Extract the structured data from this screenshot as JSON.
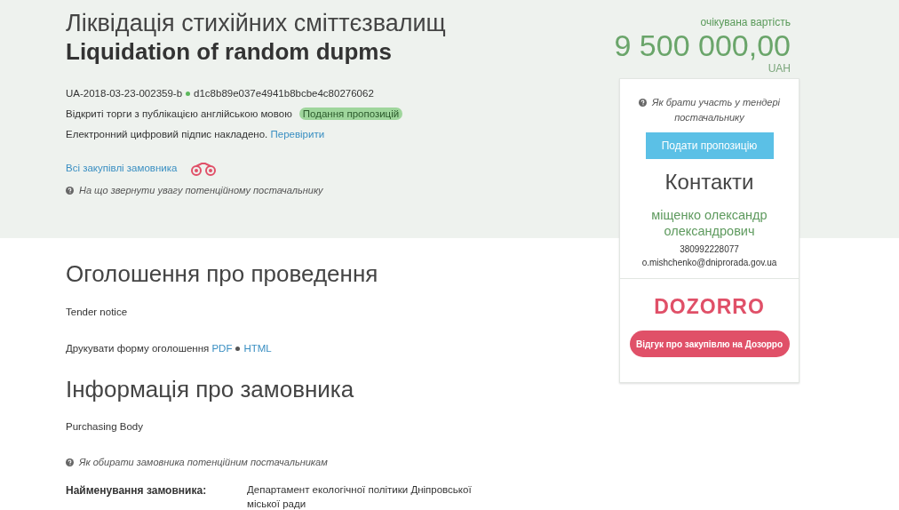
{
  "header": {
    "title_uk": "Ліквідація стихійних сміттєзвалищ",
    "title_en": "Liquidation of random dupms",
    "tender_id": "UA-2018-03-23-002359-b",
    "hash": "d1c8b89e037e4941b8bcbe4c80276062",
    "procedure": "Відкриті торги з публікацією англійською мовою",
    "status_badge": "Подання пропозицій",
    "signature_text": "Електронний цифровий підпис накладено.",
    "signature_link": "Перевірити",
    "all_purchases_link": "Всі закупівлі замовника",
    "hint": "На що звернути увагу потенційному постачальнику"
  },
  "price": {
    "label": "очікувана вартість",
    "amount": "9 500 000,00",
    "currency": "UAH"
  },
  "sidebar": {
    "hint": "Як брати участь у тендері постачальнику",
    "submit_button": "Подати пропозицію",
    "contacts_title": "Контакти",
    "contact_name": "міщенко олександр олександрович",
    "phone": "380992228077",
    "email": "o.mishchenko@dniprorada.gov.ua",
    "logo": "DOZORRO",
    "feedback_button": "Відгук про закупівлю на Дозорро"
  },
  "notice": {
    "title": "Оголошення про проведення",
    "subtitle": "Tender notice",
    "print_label": "Друкувати форму оголошення",
    "print_links": [
      "PDF",
      "HTML"
    ]
  },
  "buyer": {
    "title": "Інформація про замовника",
    "subtitle": "Purchasing Body",
    "hint": "Як обирати замовника потенційним постачальникам",
    "fields": [
      {
        "label": "Найменування замовника:",
        "value": "Департамент екологічної політики Дніпровської міської ради"
      }
    ]
  }
}
